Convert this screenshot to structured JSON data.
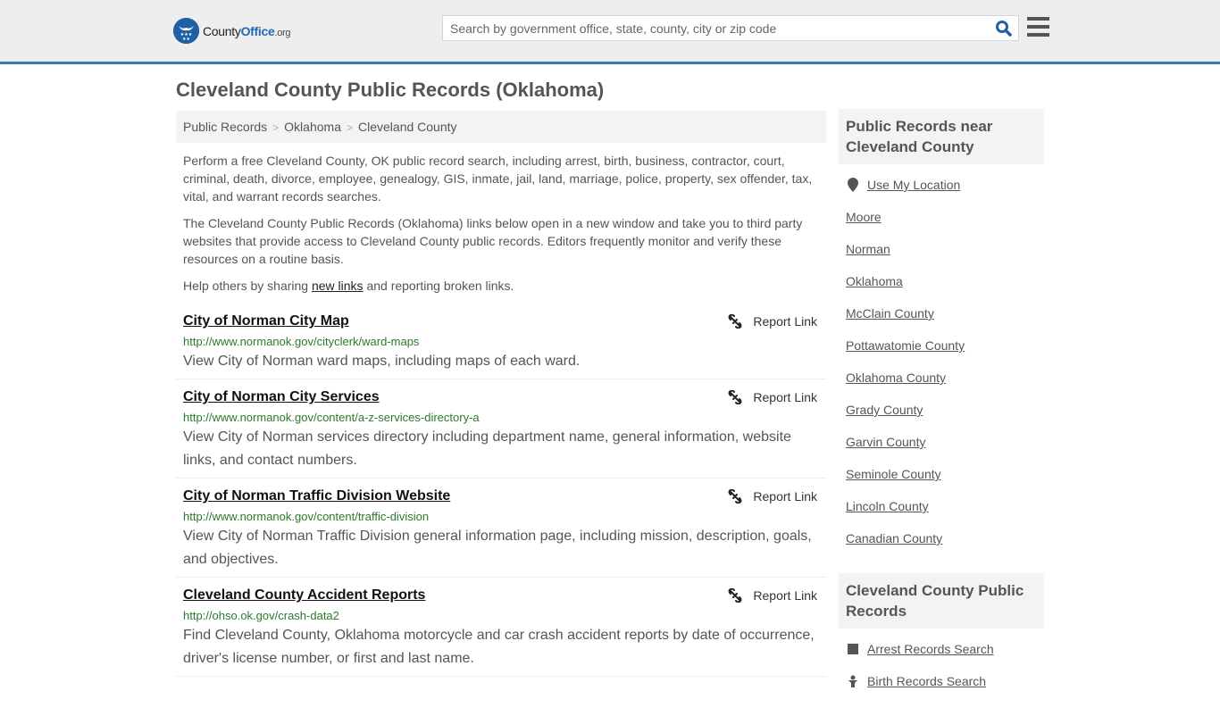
{
  "header": {
    "logo": {
      "county": "County",
      "office": "Office",
      "org": ".org"
    },
    "search_placeholder": "Search by government office, state, county, city or zip code",
    "accent_color": "#3a7cab"
  },
  "page_title": "Cleveland County Public Records (Oklahoma)",
  "breadcrumb": [
    "Public Records",
    "Oklahoma",
    "Cleveland County"
  ],
  "intro": {
    "p1": "Perform a free Cleveland County, OK public record search, including arrest, birth, business, contractor, court, criminal, death, divorce, employee, genealogy, GIS, inmate, jail, land, marriage, police, property, sex offender, tax, vital, and warrant records searches.",
    "p2": "The Cleveland County Public Records (Oklahoma) links below open in a new window and take you to third party websites that provide access to Cleveland County public records. Editors frequently monitor and verify these resources on a routine basis.",
    "p3_before": "Help others by sharing ",
    "p3_link": "new links",
    "p3_after": " and reporting broken links."
  },
  "report_label": "Report Link",
  "results": [
    {
      "title": "City of Norman City Map",
      "url": "http://www.normanok.gov/cityclerk/ward-maps",
      "desc": "View City of Norman ward maps, including maps of each ward."
    },
    {
      "title": "City of Norman City Services",
      "url": "http://www.normanok.gov/content/a-z-services-directory-a",
      "desc": "View City of Norman services directory including department name, general information, website links, and contact numbers."
    },
    {
      "title": "City of Norman Traffic Division Website",
      "url": "http://www.normanok.gov/content/traffic-division",
      "desc": "View City of Norman Traffic Division general information page, including mission, description, goals, and objectives."
    },
    {
      "title": "Cleveland County Accident Reports",
      "url": "http://ohso.ok.gov/crash-data2",
      "desc": "Find Cleveland County, Oklahoma motorcycle and car crash accident reports by date of occurrence, driver's license number, or first and last name."
    }
  ],
  "sidebar": {
    "nearby_heading": "Public Records near Cleveland County",
    "use_location": "Use My Location",
    "nearby": [
      "Moore",
      "Norman",
      "Oklahoma",
      "McClain County",
      "Pottawatomie County",
      "Oklahoma County",
      "Grady County",
      "Garvin County",
      "Seminole County",
      "Lincoln County",
      "Canadian County"
    ],
    "records_heading": "Cleveland County Public Records",
    "records": [
      {
        "label": "Arrest Records Search",
        "icon": "arrest-icon"
      },
      {
        "label": "Birth Records Search",
        "icon": "baby-icon"
      }
    ]
  }
}
